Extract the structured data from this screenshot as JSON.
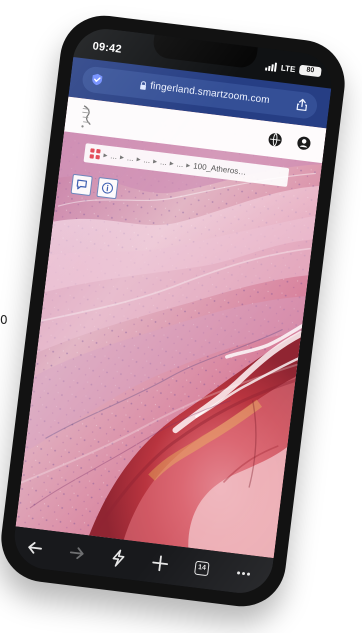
{
  "page": {
    "side_text": "0"
  },
  "status_bar": {
    "time": "09:42",
    "network": "LTE",
    "battery": "80"
  },
  "browser": {
    "url": "fingerland.smartzoom.com"
  },
  "app": {
    "breadcrumb": {
      "items": [
        "...",
        "...",
        "...",
        "...",
        "..."
      ],
      "current": "100_Atheroscl..."
    }
  },
  "toolbar": {
    "tab_count": "14",
    "menu": "..."
  },
  "icons": {
    "browser_shield": "shield-icon",
    "lock": "lock-icon",
    "share": "share-icon",
    "logo": "logo-icon",
    "globe": "globe-icon",
    "user": "user-icon",
    "grid": "grid-icon",
    "comment": "comment-icon",
    "info": "info-icon",
    "back": "back-arrow-icon",
    "forward": "forward-arrow-icon",
    "bolt": "lightning-icon",
    "add_tab": "plus-icon",
    "tabs": "tabs-icon",
    "menu": "more-icon"
  },
  "colors": {
    "browser_bar": "#263e84",
    "tissue_pink": "#d9a3b8",
    "tissue_red": "#c9414e",
    "tool_border": "#6f87bd",
    "toolbar": "#18191c"
  }
}
